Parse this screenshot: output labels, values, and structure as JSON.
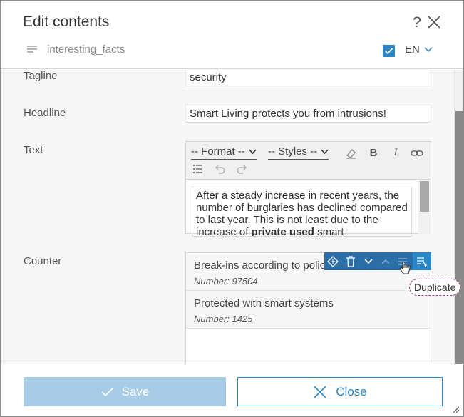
{
  "header": {
    "title": "Edit contents",
    "help": "?",
    "subject": "interesting_facts",
    "language": "EN",
    "language_enabled": true
  },
  "fields": {
    "tagline": {
      "label": "Tagline",
      "value": "security"
    },
    "headline": {
      "label": "Headline",
      "value": "Smart Living protects you from intrusions!"
    },
    "text": {
      "label": "Text",
      "format_placeholder": "-- Format --",
      "styles_placeholder": "-- Styles --",
      "content_part1": "After a steady increase in recent years, the number of burglaries has declined compared to last year. This is not least due to the increase of ",
      "content_bold": "private used",
      "content_part2": " smart"
    },
    "counter": {
      "label": "Counter",
      "items": [
        {
          "title": "Break-ins according to police",
          "subtitle": "Number: 97504"
        },
        {
          "title": "Protected with smart systems",
          "subtitle": "Number: 1425"
        }
      ]
    }
  },
  "tooltip": "Duplicate",
  "footer": {
    "save_label": "Save",
    "close_label": "Close"
  },
  "colors": {
    "accent": "#2b85c6",
    "accent_disabled": "#a8cbe6",
    "item_toolbar": "#2b6ea8"
  }
}
